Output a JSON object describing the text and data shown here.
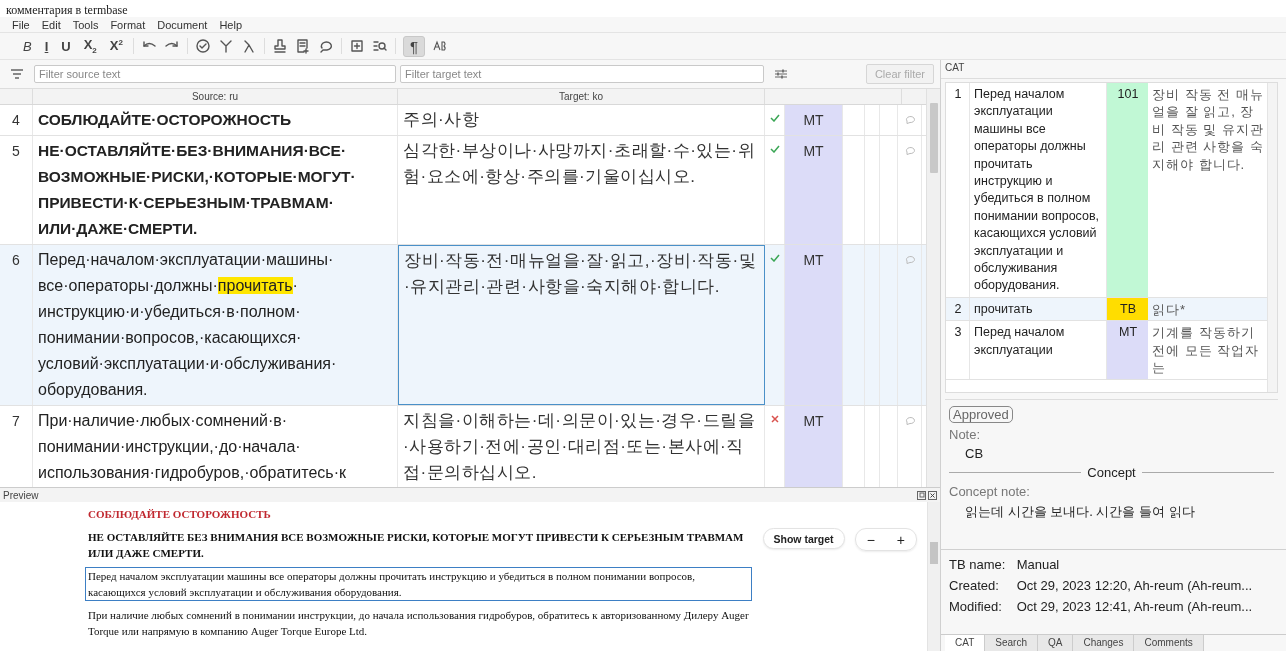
{
  "caption": "комментария в termbase",
  "menu": [
    "File",
    "Edit",
    "Tools",
    "Format",
    "Document",
    "Help"
  ],
  "toolbar": {
    "format_buttons": [
      "B",
      "I",
      "U",
      "X$_{2}$",
      "X$^{2}$"
    ],
    "marks_toggle": {
      "label": "¶",
      "selected": true
    }
  },
  "filters": {
    "source_placeholder": "Filter source text",
    "target_placeholder": "Filter target text",
    "clear_filter": {
      "label": "Clear filter",
      "disabled": true
    }
  },
  "grid": {
    "columns": [
      "Source: ru",
      "Target: ko"
    ],
    "rows": [
      {
        "number": "4",
        "bold": true,
        "source": [
          [
            {
              "text": "СОБЛЮДАЙТЕ·ОСТОРОЖНОСТЬ",
              "highlight": false
            }
          ]
        ],
        "target": "주의·사항",
        "confirmed": true,
        "origin": "MT",
        "selected": false
      },
      {
        "number": "5",
        "bold": true,
        "source": [
          [
            {
              "text": "НЕ·ОСТАВЛЯЙТЕ·БЕЗ·ВНИМАНИЯ·ВСЕ·",
              "highlight": false
            }
          ],
          [
            {
              "text": "ВОЗМОЖНЫЕ·РИСКИ,·КОТОРЫЕ·МОГУТ·",
              "highlight": false
            }
          ],
          [
            {
              "text": "ПРИВЕСТИ·К·СЕРЬЕЗНЫМ·ТРАВМАМ·",
              "highlight": false
            }
          ],
          [
            {
              "text": "ИЛИ·ДАЖЕ·СМЕРТИ.",
              "highlight": false
            }
          ]
        ],
        "target": "심각한·부상이나·사망까지·초래할·수·있는·위험·요소에·항상·주의를·기울이십시오.",
        "confirmed": true,
        "origin": "MT",
        "selected": false
      },
      {
        "number": "6",
        "bold": false,
        "source": [
          [
            {
              "text": "Перед·началом·эксплуатации·машины·",
              "highlight": false
            }
          ],
          [
            {
              "text": "все·операторы·должны·",
              "highlight": false
            },
            {
              "text": "прочитать",
              "highlight": true
            },
            {
              "text": "·",
              "highlight": false
            }
          ],
          [
            {
              "text": "инструкцию·и·убедиться·в·полном·",
              "highlight": false
            }
          ],
          [
            {
              "text": "понимании·вопросов,·касающихся·",
              "highlight": false
            }
          ],
          [
            {
              "text": "условий·эксплуатации·и·обслуживания·",
              "highlight": false
            }
          ],
          [
            {
              "text": "оборудования.",
              "highlight": false
            }
          ]
        ],
        "target": "장비·작동·전·매뉴얼을·잘·읽고,·장비·작동·및·유지관리·관련·사항을·숙지해야·합니다.",
        "confirmed": true,
        "origin": "MT",
        "selected": true
      },
      {
        "number": "7",
        "bold": false,
        "source": [
          [
            {
              "text": "При·наличие·любых·сомнений·в·",
              "highlight": false
            }
          ],
          [
            {
              "text": "понимании·инструкции,·до·начала·",
              "highlight": false
            }
          ],
          [
            {
              "text": "использования·гидробуров,·обратитесь·к",
              "highlight": false
            }
          ]
        ],
        "target": "지침을·이해하는·데·의문이·있는·경우·드릴을·사용하기·전에·공인·대리점·또는·본사에·직접·문의하십시오.",
        "confirmed": false,
        "origin": "MT",
        "selected": false
      }
    ]
  },
  "preview": {
    "title": "Preview",
    "show_target": "Show target",
    "zoom_out": "−",
    "zoom_in": "+",
    "paragraphs": [
      {
        "kind": "title",
        "text": "СОБЛЮДАЙТЕ ОСТОРОЖНОСТЬ",
        "selected": false
      },
      {
        "kind": "bold",
        "text": "НЕ ОСТАВЛЯЙТЕ БЕЗ ВНИМАНИЯ ВСЕ ВОЗМОЖНЫЕ РИСКИ, КОТОРЫЕ МОГУТ ПРИВЕСТИ К СЕРЬЕЗНЫМ ТРАВМАМ ИЛИ ДАЖЕ СМЕРТИ.",
        "selected": false
      },
      {
        "kind": "normal",
        "text": "Перед началом эксплуатации машины все операторы должны прочитать инструкцию и убедиться в полном понимании вопросов, касающихся условий эксплуатации и обслуживания оборудования.",
        "selected": true
      },
      {
        "kind": "normal",
        "text": "При наличие любых сомнений в понимании инструкции, до начала использования гидробуров, обратитесь к авторизованному Дилеру Auger Torque или напрямую в компанию Auger Torque Europe Ltd.",
        "selected": false
      }
    ]
  },
  "cat": {
    "title": "CAT",
    "results": [
      {
        "number": "1",
        "source": "Перед началом эксплуатации машины все операторы должны прочитать инструкцию и убедиться в полном понимании вопросов, касающихся условий  эксплуатации и обслуживания оборудования.",
        "match": "101",
        "color": "#c1f8d5",
        "target": "장비 작동 전 매뉴얼을 잘 읽고, 장비 작동 및 유지관리 관련 사항을 숙지해야 합니다.",
        "selected": false
      },
      {
        "number": "2",
        "source": "прочитать",
        "match": "TB",
        "color": "#ffdd00",
        "target": "읽다*",
        "selected": true
      },
      {
        "number": "3",
        "source": "Перед началом эксплуатации",
        "match": "MT",
        "color": "#dcdcf8",
        "target": "기계를 작동하기 전에 모든 작업자는",
        "selected": false
      }
    ],
    "status": "Approved",
    "note_label": "Note:",
    "note": "CB",
    "concept_heading": "Concept",
    "concept_note_label": "Concept note:",
    "concept_note": "읽는데 시간을 보내다. 시간을 들여 읽다",
    "info": [
      {
        "label": "TB name:",
        "value": "Manual"
      },
      {
        "label": "Created:",
        "value": "Oct 29, 2023 12:20, Ah-reum (Ah-reum..."
      },
      {
        "label": "Modified:",
        "value": "Oct 29, 2023 12:41, Ah-reum (Ah-reum..."
      }
    ],
    "tabs": [
      {
        "label": "CAT",
        "selected": true
      },
      {
        "label": "Search",
        "selected": false
      },
      {
        "label": "QA",
        "selected": false
      },
      {
        "label": "Changes",
        "selected": false
      },
      {
        "label": "Comments",
        "selected": false
      }
    ]
  }
}
